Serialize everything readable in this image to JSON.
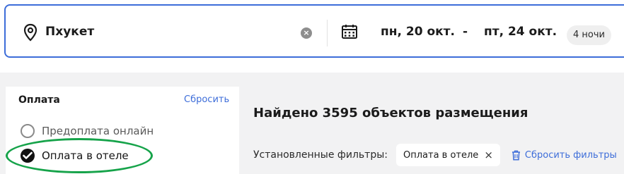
{
  "search": {
    "destination": "Пхукет",
    "date_from": "пн, 20 окт.",
    "date_separator": "-",
    "date_to": "пт, 24 окт.",
    "nights": "4 ночи",
    "clear_glyph": "×"
  },
  "filters_panel": {
    "title": "Оплата",
    "reset_label": "Сбросить",
    "options": [
      {
        "label": "Предоплата онлайн",
        "checked": false
      },
      {
        "label": "Оплата в отеле",
        "checked": true
      }
    ]
  },
  "results": {
    "found_text": "Найдено 3595 объектов размещения",
    "applied_filters_label": "Установленные фильтры:",
    "chips": [
      {
        "label": "Оплата в отеле",
        "remove_glyph": "×"
      }
    ],
    "reset_filters_label": "Сбросить фильтры"
  },
  "colors": {
    "accent": "#3d6dd9",
    "background": "#f2f2f3",
    "highlight": "#16a34a"
  },
  "icons": [
    "location-pin-icon",
    "clear-icon",
    "calendar-icon",
    "checkmark-icon",
    "close-icon",
    "trash-icon"
  ]
}
